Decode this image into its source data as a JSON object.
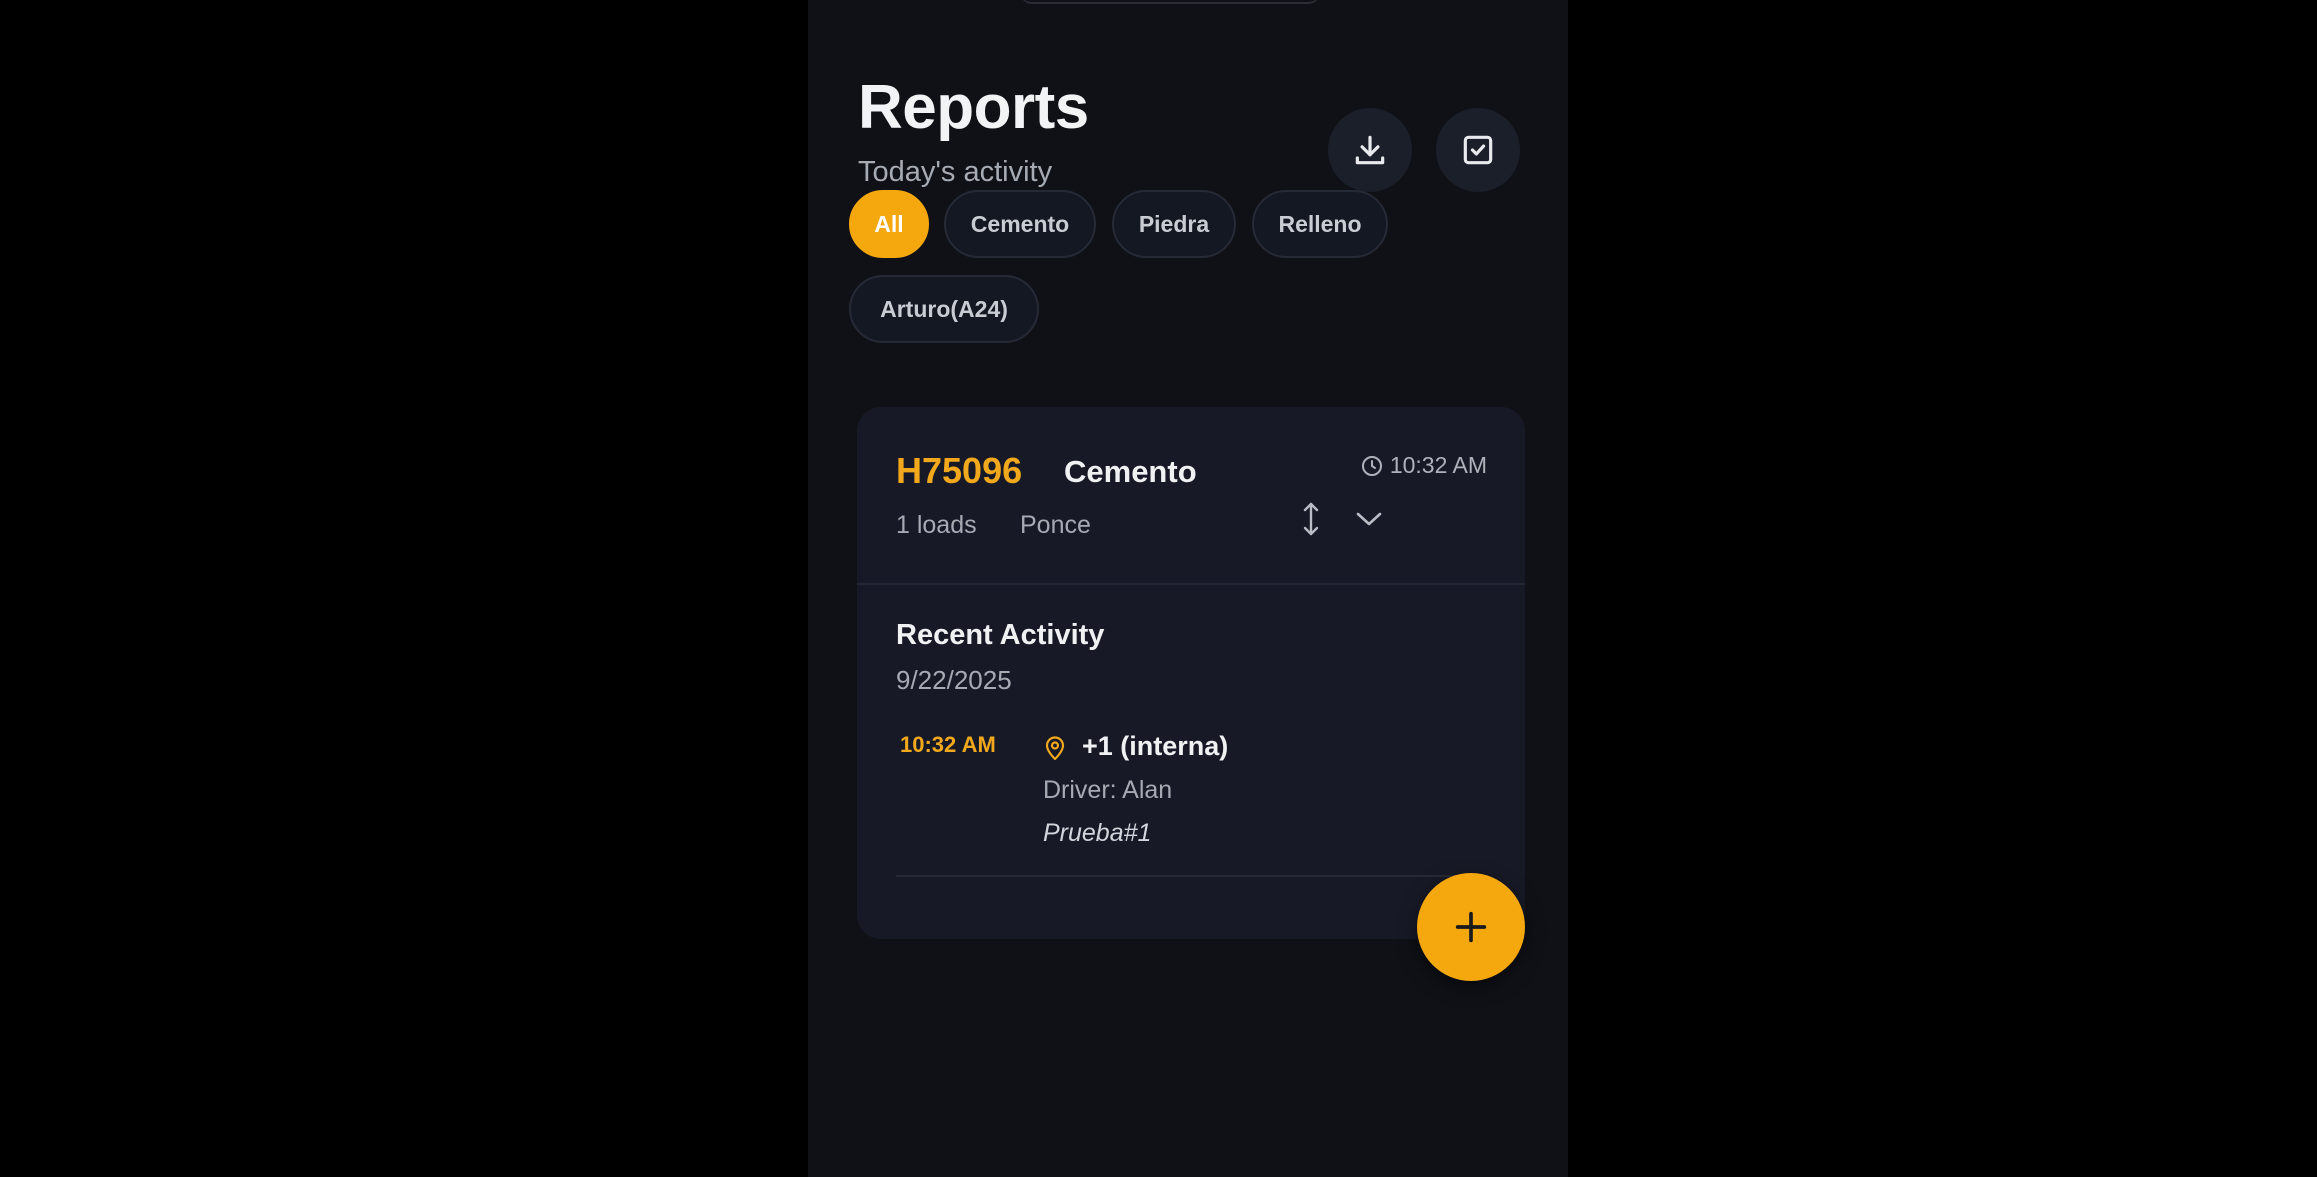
{
  "header": {
    "title": "Reports",
    "subtitle": "Today's activity",
    "download_icon": "download-icon",
    "select_icon": "checkbox-icon"
  },
  "filters": {
    "chips": [
      {
        "label": "All",
        "active": true
      },
      {
        "label": "Cemento",
        "active": false
      },
      {
        "label": "Piedra",
        "active": false
      },
      {
        "label": "Relleno",
        "active": false
      },
      {
        "label": "Arturo(A24)",
        "active": false
      }
    ]
  },
  "card": {
    "code": "H75096",
    "material": "Cemento",
    "time": "10:32 AM",
    "loads": "1 loads",
    "place": "Ponce",
    "recent_title": "Recent Activity",
    "recent_date": "9/22/2025",
    "activity": {
      "time": "10:32 AM",
      "title": "+1 (interna)",
      "driver": "Driver: Alan",
      "note": "Prueba#1"
    }
  },
  "colors": {
    "accent": "#f5a70e",
    "background": "#0f1117",
    "card": "#171a26"
  }
}
